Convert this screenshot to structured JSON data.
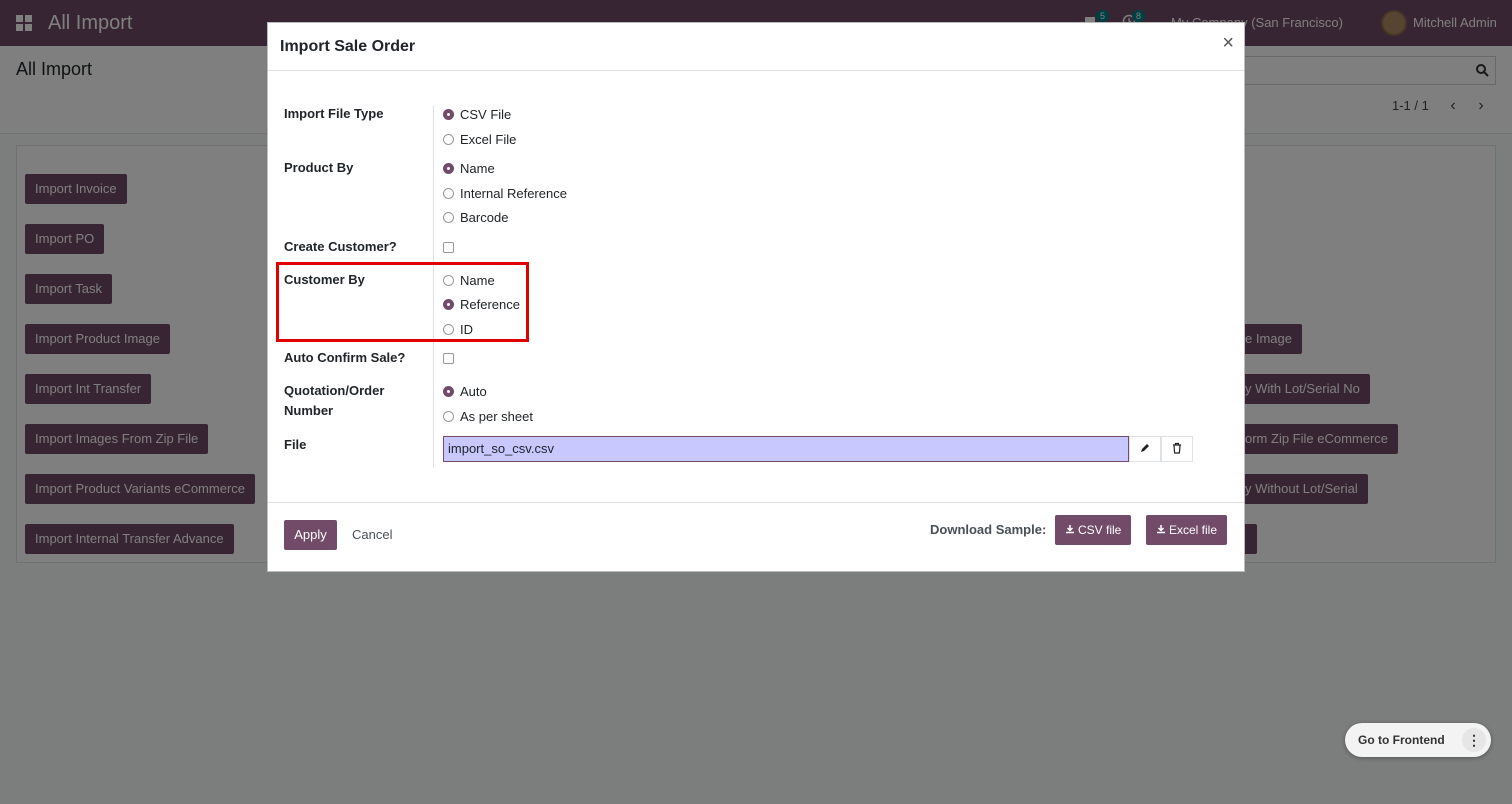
{
  "navbar": {
    "title": "All Import",
    "messages_badge": "5",
    "activities_badge": "8",
    "company": "My Company (San Francisco)",
    "user": "Mitchell Admin"
  },
  "control_panel": {
    "title": "All Import",
    "pager": "1-1 / 1"
  },
  "import_buttons": [
    "Import Invoice",
    "Import PO",
    "Import Task",
    "Import Product Image",
    "Import Int Transfer",
    "Import Images From Zip File",
    "Import Product Variants eCommerce",
    "Import Internal Transfer Advance"
  ],
  "right_buttons": [
    "e Image",
    "y With Lot/Serial No",
    "orm Zip File eCommerce",
    "y Without Lot/Serial"
  ],
  "modal": {
    "title": "Import Sale Order",
    "close": "×",
    "fields": {
      "file_type": {
        "label": "Import File Type",
        "options": [
          "CSV File",
          "Excel File"
        ],
        "selected": "CSV File"
      },
      "product_by": {
        "label": "Product By",
        "options": [
          "Name",
          "Internal Reference",
          "Barcode"
        ],
        "selected": "Name"
      },
      "create_customer": {
        "label": "Create Customer?",
        "checked": false
      },
      "customer_by": {
        "label": "Customer By",
        "options": [
          "Name",
          "Reference",
          "ID"
        ],
        "selected": "Reference"
      },
      "auto_confirm": {
        "label": "Auto Confirm Sale?",
        "checked": false
      },
      "order_number": {
        "label_line1": "Quotation/Order",
        "label_line2": "Number",
        "options": [
          "Auto",
          "As per sheet"
        ],
        "selected": "Auto"
      },
      "file": {
        "label": "File",
        "value": "import_so_csv.csv"
      }
    },
    "footer": {
      "apply": "Apply",
      "cancel": "Cancel",
      "download_label": "Download Sample:",
      "csv_button": "CSV file",
      "excel_button": "Excel file"
    }
  },
  "floating": {
    "frontend": "Go to Frontend",
    "more": "⋮"
  },
  "colors": {
    "brand": "#714b67",
    "highlight": "#e00000",
    "file_input_bg": "#c8c8ff"
  }
}
